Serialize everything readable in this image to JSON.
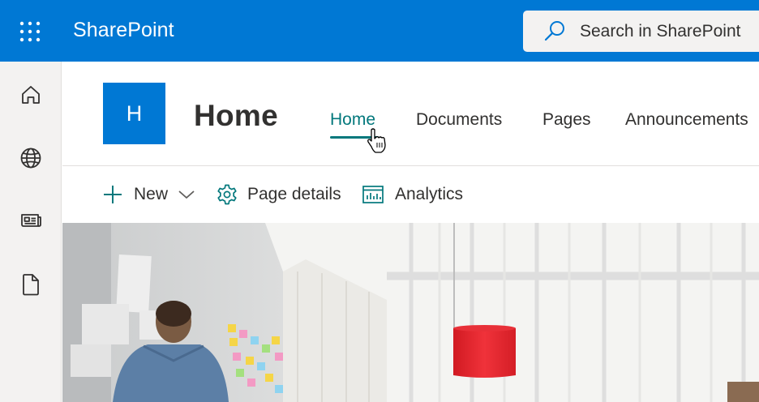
{
  "suite_bar": {
    "app_name": "SharePoint",
    "search_placeholder": "Search in SharePoint",
    "color": "#0078d4"
  },
  "app_bar": {
    "items": [
      {
        "icon": "home-icon"
      },
      {
        "icon": "globe-icon"
      },
      {
        "icon": "news-icon"
      },
      {
        "icon": "document-icon"
      }
    ]
  },
  "site": {
    "logo_letter": "H",
    "title": "Home",
    "nav": [
      {
        "label": "Home",
        "active": true
      },
      {
        "label": "Documents",
        "active": false
      },
      {
        "label": "Pages",
        "active": false
      },
      {
        "label": "Announcements",
        "active": false
      }
    ],
    "accent": "#03787c"
  },
  "command_bar": {
    "new_label": "New",
    "page_details_label": "Page details",
    "analytics_label": "Analytics"
  }
}
